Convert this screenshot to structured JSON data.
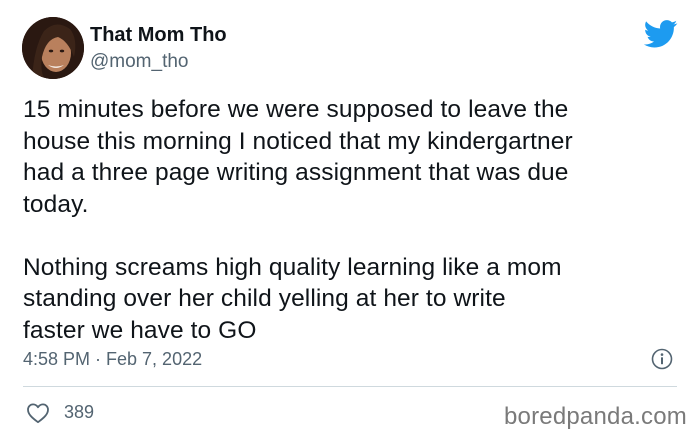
{
  "author": {
    "display_name": "That Mom Tho",
    "handle": "@mom_tho",
    "avatar_icon": "profile-photo"
  },
  "tweet": {
    "paragraphs": [
      [
        "15 minutes before we were supposed to leave the",
        "house this morning I noticed that my kindergartner",
        "had a three page writing assignment that was due",
        "today."
      ],
      [
        "Nothing screams high quality learning like a mom",
        "standing over her child yelling at her to write",
        "faster we have to GO"
      ]
    ],
    "timestamp": "4:58 PM · Feb 7, 2022"
  },
  "actions": {
    "like_count": "389"
  },
  "watermark": "boredpanda.com",
  "icons": {
    "brand": "twitter-bird-icon",
    "info": "info-icon",
    "like": "heart-icon"
  },
  "colors": {
    "twitter_blue": "#1d9bf0",
    "text_primary": "#0f1419",
    "text_secondary": "#536471",
    "divider": "#cfd9de"
  }
}
